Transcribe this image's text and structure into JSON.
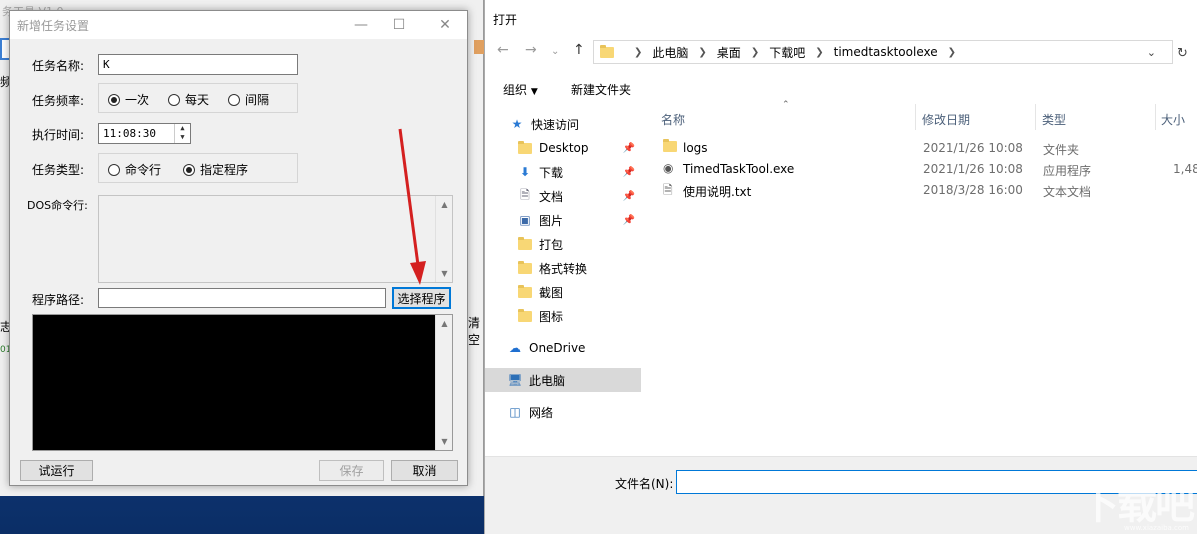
{
  "bg_app": {
    "title_fragment": "务工具 V1.0",
    "freq_fragment": "频",
    "log_fragment": "志",
    "log_line": "01-",
    "clear_fragment": "清空"
  },
  "dialog": {
    "title": "新增任务设置",
    "task_name_label": "任务名称:",
    "task_name_value": "K",
    "frequency_label": "任务频率:",
    "freq_options": [
      "一次",
      "每天",
      "间隔"
    ],
    "freq_selected": "一次",
    "time_label": "执行时间:",
    "time_value": "11:08:30",
    "type_label": "任务类型:",
    "type_options": [
      "命令行",
      "指定程序"
    ],
    "type_selected": "指定程序",
    "dos_label": "DOS命令行:",
    "path_label": "程序路径:",
    "select_button": "选择程序",
    "test_button": "试运行",
    "save_button": "保存",
    "cancel_button": "取消"
  },
  "file_dialog": {
    "title": "打开",
    "breadcrumb": [
      "此电脑",
      "桌面",
      "下载吧",
      "timedtasktoolexe"
    ],
    "organize": "组织",
    "new_folder": "新建文件夹",
    "nav": [
      {
        "label": "快速访问",
        "icon": "star-icon",
        "pinned": false
      },
      {
        "label": "Desktop",
        "icon": "folder-icon",
        "pinned": true
      },
      {
        "label": "下载",
        "icon": "download-icon",
        "pinned": true
      },
      {
        "label": "文档",
        "icon": "document-icon",
        "pinned": true
      },
      {
        "label": "图片",
        "icon": "picture-icon",
        "pinned": true
      },
      {
        "label": "打包",
        "icon": "folder-icon",
        "pinned": false
      },
      {
        "label": "格式转换",
        "icon": "folder-icon",
        "pinned": false
      },
      {
        "label": "截图",
        "icon": "folder-icon",
        "pinned": false
      },
      {
        "label": "图标",
        "icon": "folder-icon",
        "pinned": false
      },
      {
        "label": "OneDrive",
        "icon": "cloud-icon",
        "pinned": false
      },
      {
        "label": "此电脑",
        "icon": "computer-icon",
        "pinned": false
      },
      {
        "label": "网络",
        "icon": "network-icon",
        "pinned": false
      }
    ],
    "columns": [
      "名称",
      "修改日期",
      "类型",
      "大小"
    ],
    "files": [
      {
        "name": "logs",
        "date": "2021/1/26 10:08",
        "type": "文件夹",
        "size": "",
        "icon": "folder-icon"
      },
      {
        "name": "TimedTaskTool.exe",
        "date": "2021/1/26 10:08",
        "type": "应用程序",
        "size": "1,48",
        "icon": "exe-icon"
      },
      {
        "name": "使用说明.txt",
        "date": "2018/3/28 16:00",
        "type": "文本文档",
        "size": "",
        "icon": "text-file-icon"
      }
    ],
    "filename_label": "文件名(N):"
  },
  "watermark": {
    "text": "下载吧",
    "sub": "www.xiazaiba.com"
  },
  "colors": {
    "accent": "#0078d7",
    "arrow": "#d42020",
    "folder": "#f8d775"
  }
}
